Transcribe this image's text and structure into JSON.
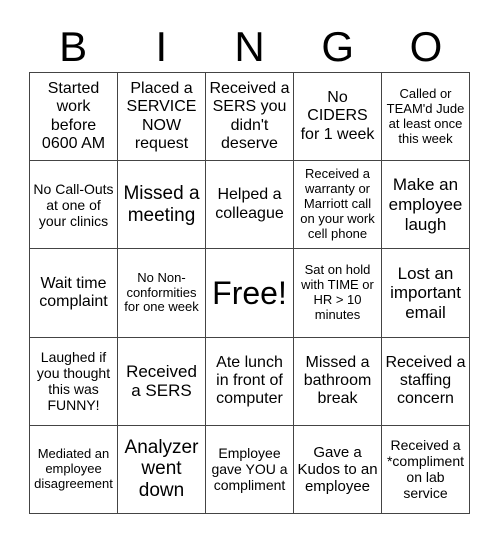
{
  "header": {
    "letters": [
      "B",
      "I",
      "N",
      "G",
      "O"
    ]
  },
  "cells": [
    [
      "Started work before 0600 AM",
      "Placed a SERVICE NOW request",
      "Received a SERS you didn't deserve",
      "No CIDERS for 1 week",
      "Called or TEAM'd Jude at least once this week"
    ],
    [
      "No Call-Outs at one of your clinics",
      "Missed a meeting",
      "Helped a colleague",
      "Received a warranty or Marriott call on your work cell phone",
      "Make an employee laugh"
    ],
    [
      "Wait time complaint",
      "No Non-conformities for one week",
      "Free!",
      "Sat on hold with TIME or HR > 10 minutes",
      "Lost an important email"
    ],
    [
      "Laughed if you thought this was FUNNY!",
      "Received a SERS",
      "Ate lunch in front of computer",
      "Missed a bathroom break",
      "Received a staffing concern"
    ],
    [
      "Mediated an employee disagreement",
      "Analyzer went down",
      "Employee gave YOU a compliment",
      "Gave a Kudos to an employee",
      "Received a *compliment on lab service"
    ]
  ]
}
